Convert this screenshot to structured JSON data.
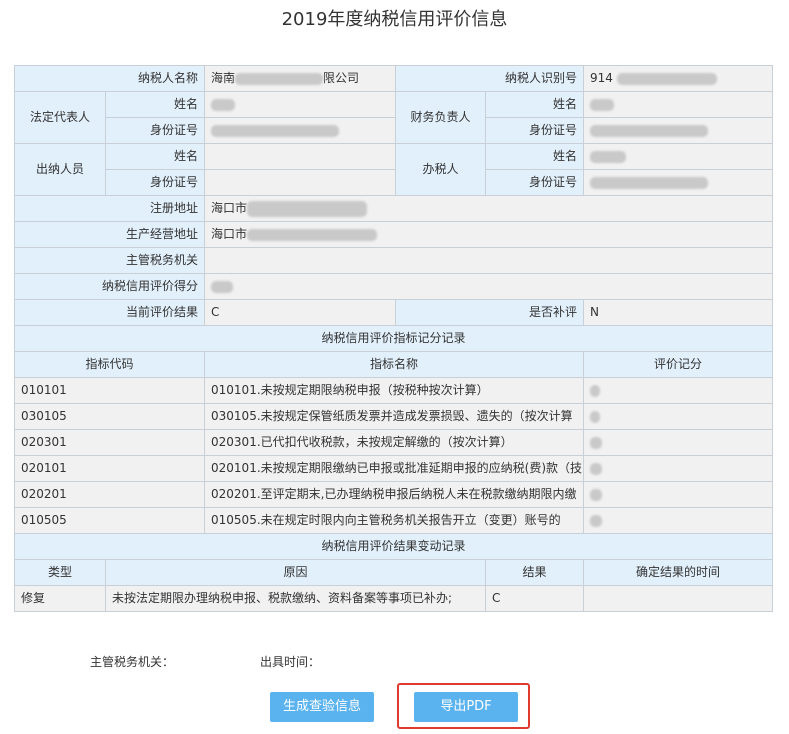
{
  "page": {
    "title": "2019年度纳税信用评价信息"
  },
  "taxpayer": {
    "name_label": "纳税人名称",
    "name_prefix": "海南",
    "name_suffix": "限公司",
    "id_label": "纳税人识别号",
    "id_prefix": "914"
  },
  "legal_rep": {
    "group_label": "法定代表人",
    "name_label": "姓名",
    "idcard_label": "身份证号"
  },
  "finance_head": {
    "group_label": "财务负责人",
    "name_label": "姓名",
    "idcard_label": "身份证号"
  },
  "cashier": {
    "group_label": "出纳人员",
    "name_label": "姓名",
    "idcard_label": "身份证号"
  },
  "tax_officer": {
    "group_label": "办税人",
    "name_label": "姓名",
    "idcard_label": "身份证号"
  },
  "address": {
    "reg_label": "注册地址",
    "reg_prefix": "海口市",
    "biz_label": "生产经营地址",
    "biz_prefix": "海口市"
  },
  "authority": {
    "label": "主管税务机关"
  },
  "score": {
    "label": "纳税信用评价得分"
  },
  "result": {
    "label": "当前评价结果",
    "value": "C",
    "supplement_label": "是否补评",
    "supplement_value": "N"
  },
  "indicators": {
    "section_title": "纳税信用评价指标记分记录",
    "headers": [
      "指标代码",
      "指标名称",
      "评价记分"
    ],
    "rows": [
      {
        "code": "010101",
        "name": "010101.未按规定期限纳税申报（按税种按次计算）"
      },
      {
        "code": "030105",
        "name": "030105.未按规定保管纸质发票并造成发票损毁、遗失的（按次计算"
      },
      {
        "code": "020301",
        "name": "020301.已代扣代收税款，未按规定解缴的（按次计算）"
      },
      {
        "code": "020101",
        "name": "020101.未按规定期限缴纳已申报或批准延期申报的应纳税(费)款（技"
      },
      {
        "code": "020201",
        "name": "020201.至评定期末,已办理纳税申报后纳税人未在税款缴纳期限内缴"
      },
      {
        "code": "010505",
        "name": "010505.未在规定时限内向主管税务机关报告开立（变更）账号的"
      }
    ]
  },
  "changes": {
    "section_title": "纳税信用评价结果变动记录",
    "headers": [
      "类型",
      "原因",
      "结果",
      "确定结果的时间"
    ],
    "rows": [
      {
        "type": "修复",
        "reason": "未按法定期限办理纳税申报、税款缴纳、资料备案等事项已补办;",
        "result": "C",
        "time": ""
      }
    ]
  },
  "footer": {
    "authority_label": "主管税务机关：",
    "issue_time_label": "出具时间："
  },
  "actions": {
    "generate_label": "生成查验信息",
    "export_label": "导出PDF"
  }
}
